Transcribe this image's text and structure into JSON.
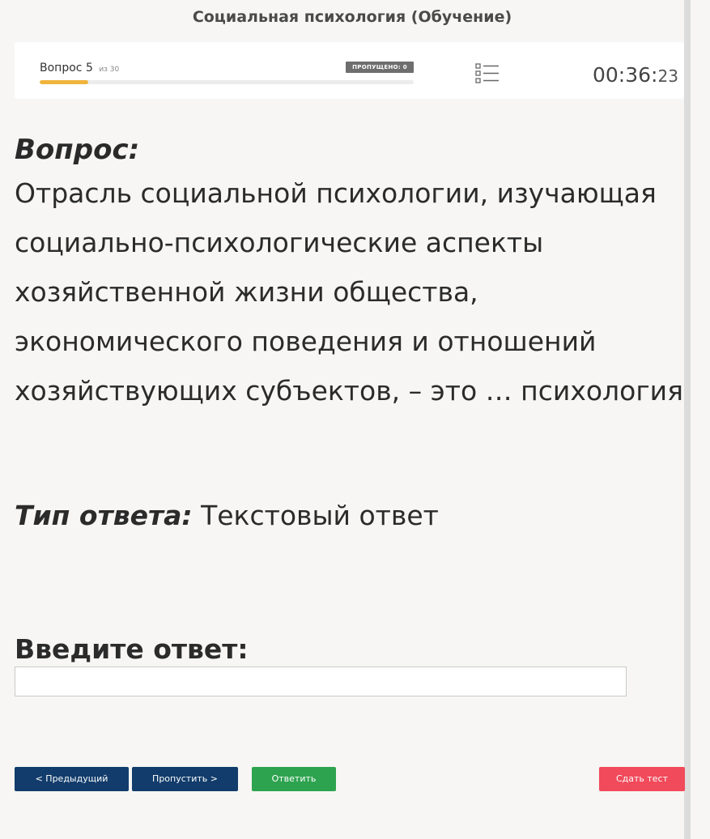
{
  "header": {
    "title": "Социальная психология (Обучение)"
  },
  "status_bar": {
    "question_word": "Вопрос",
    "question_number": "5",
    "of_total": "из 30",
    "skipped_badge": "ПРОПУЩЕНО: 0",
    "progress_fraction": 0.13,
    "progress_color": "#f0b43c",
    "list_icon": "question-list-icon",
    "timer_main": "00:36:",
    "timer_seconds": "23"
  },
  "question": {
    "label": "Вопрос:",
    "text": "Отрасль социальной психологии, изучающая социально-психологические аспекты хозяйственной жизни общества, экономического поведения и отношений хозяйствующих субъектов, – это … психология"
  },
  "answer_type": {
    "label": "Тип ответа:",
    "value": "Текстовый ответ"
  },
  "answer_input": {
    "label": "Введите ответ:",
    "value": "",
    "placeholder": ""
  },
  "buttons": {
    "prev": "< Предыдущий",
    "skip": "Пропустить >",
    "answer": "Ответить",
    "submit": "Сдать тест"
  },
  "colors": {
    "nav_button": "#123c6b",
    "answer_button": "#2ea34f",
    "submit_button": "#f04a5b"
  }
}
